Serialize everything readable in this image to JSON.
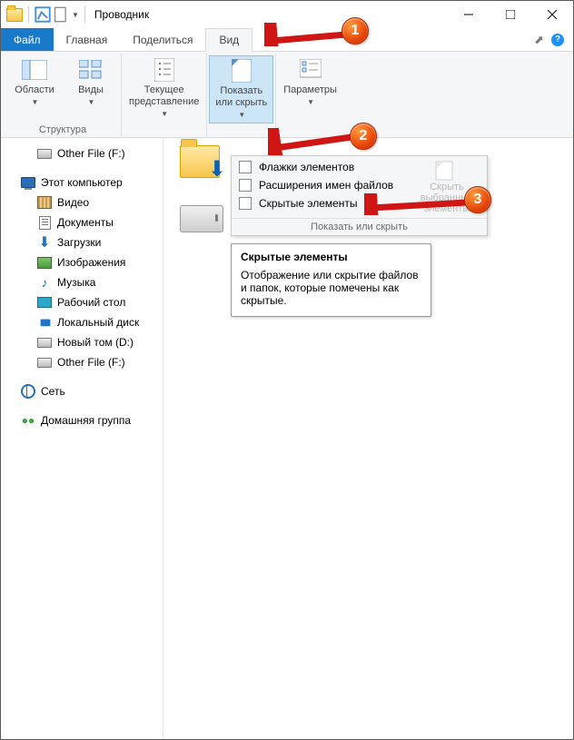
{
  "title": "Проводник",
  "tabs": {
    "file": "Файл",
    "home": "Главная",
    "share": "Поделиться",
    "view": "Вид"
  },
  "ribbon": {
    "areas": "Области",
    "views": "Виды",
    "current": "Текущее\nпредставление",
    "showhide": "Показать\nили скрыть",
    "options": "Параметры",
    "group_structure": "Структура"
  },
  "nav": {
    "otherFileF": "Other File (F:)",
    "thisPC": "Этот компьютер",
    "video": "Видео",
    "documents": "Документы",
    "downloads": "Загрузки",
    "pictures": "Изображения",
    "music": "Музыка",
    "desktop": "Рабочий стол",
    "localDisk": "Локальный диск",
    "newVolD": "Новый том (D:)",
    "otherFileF2": "Other File (F:)",
    "network": "Сеть",
    "homegroup": "Домашняя группа"
  },
  "popup": {
    "opt1": "Флажки элементов",
    "opt2": "Расширения имен файлов",
    "opt3": "Скрытые элементы",
    "selcol": "Скрыть выбранные элементы",
    "footer": "Показать или скрыть"
  },
  "tooltip": {
    "title": "Скрытые элементы",
    "body": "Отображение или скрытие файлов и папок, которые помечены как скрытые."
  },
  "callouts": {
    "c1": "1",
    "c2": "2",
    "c3": "3"
  }
}
